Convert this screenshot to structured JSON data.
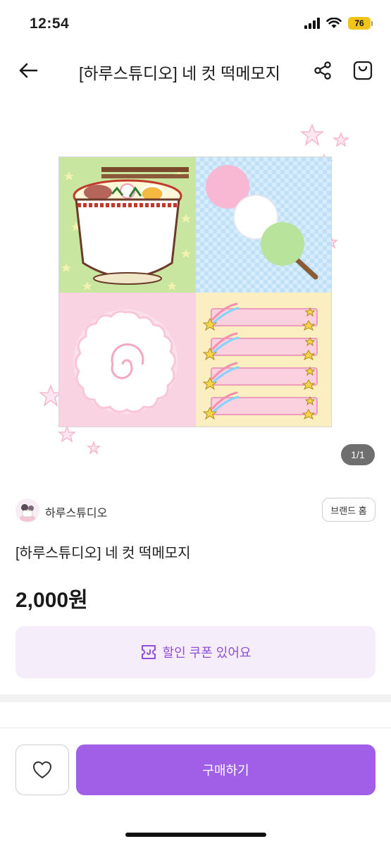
{
  "status_bar": {
    "time": "12:54",
    "battery": "76"
  },
  "nav": {
    "title": "[하루스튜디오] 네 컷 떡메모지",
    "back_icon": "arrow-left-icon",
    "share_icon": "share-icon",
    "bag_icon": "shopping-bag-icon"
  },
  "product": {
    "image_indicator": "1/1",
    "seller_name": "하루스튜디오",
    "brand_home_label": "브랜드 홈",
    "name": "[하루스튜디오] 네 컷 떡메모지",
    "price": "2,000원",
    "coupon_label": "할인 쿠폰 있어요"
  },
  "actions": {
    "buy_label": "구매하기",
    "wish_icon": "heart-icon"
  },
  "colors": {
    "accent": "#a05fe6",
    "coupon_bg": "#f6edfb",
    "coupon_text": "#8f4fd6"
  }
}
